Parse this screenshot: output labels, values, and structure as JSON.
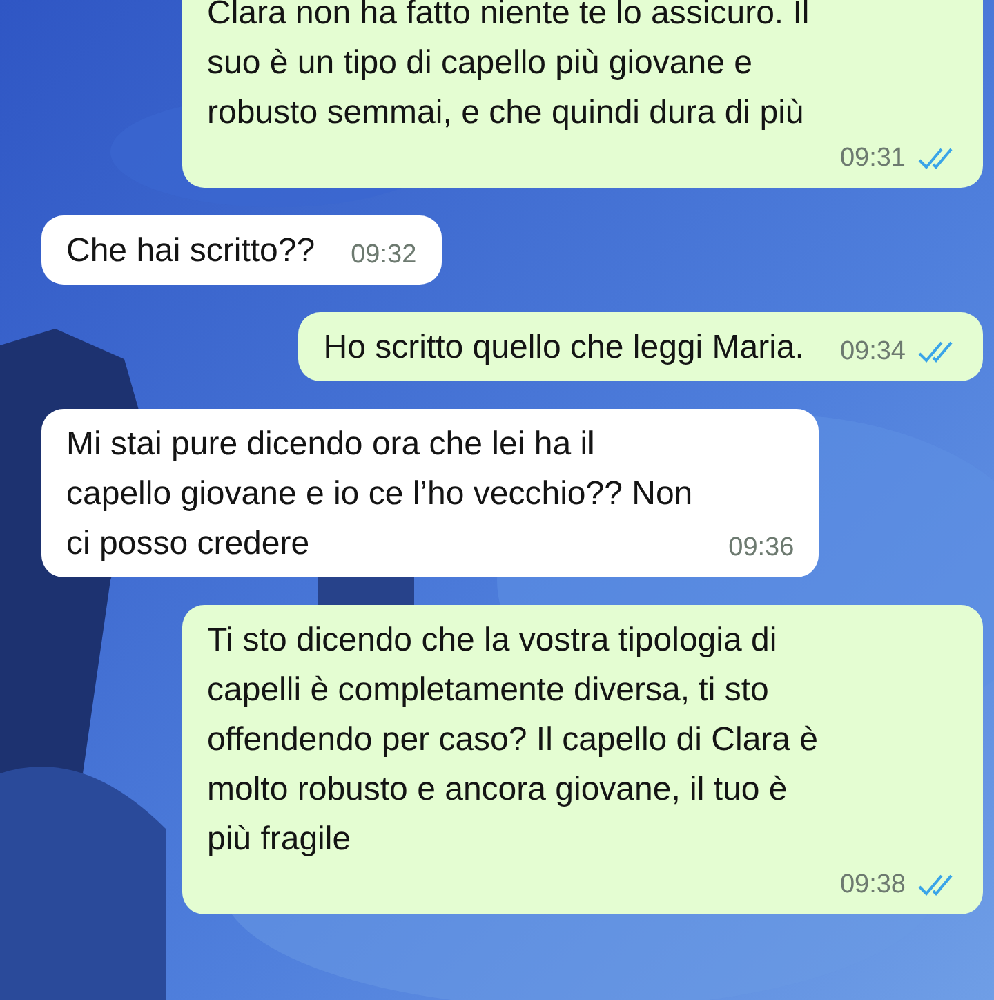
{
  "messages": [
    {
      "kind": "outgoing",
      "text": "Clara non ha fatto niente te lo assicuro. Il\nsuo è un tipo di capello più giovane e\nrobusto semmai, e che quindi dura di più",
      "time": "09:31",
      "read": true
    },
    {
      "kind": "incoming",
      "text": "Che hai scritto??",
      "time": "09:32"
    },
    {
      "kind": "outgoing",
      "text": "Ho scritto quello che leggi Maria.",
      "time": "09:34",
      "read": true
    },
    {
      "kind": "incoming",
      "text": "Mi stai pure dicendo ora che lei ha il\ncapello giovane e io ce l’ho vecchio?? Non\nci posso credere",
      "time": "09:36"
    },
    {
      "kind": "outgoing",
      "text": "Ti sto dicendo che la vostra tipologia di\ncapelli è completamente diversa, ti sto\noffendendo per caso? Il capello di Clara è\nmolto robusto e ancora giovane, il tuo è\npiù fragile",
      "time": "09:38",
      "read": true
    }
  ]
}
